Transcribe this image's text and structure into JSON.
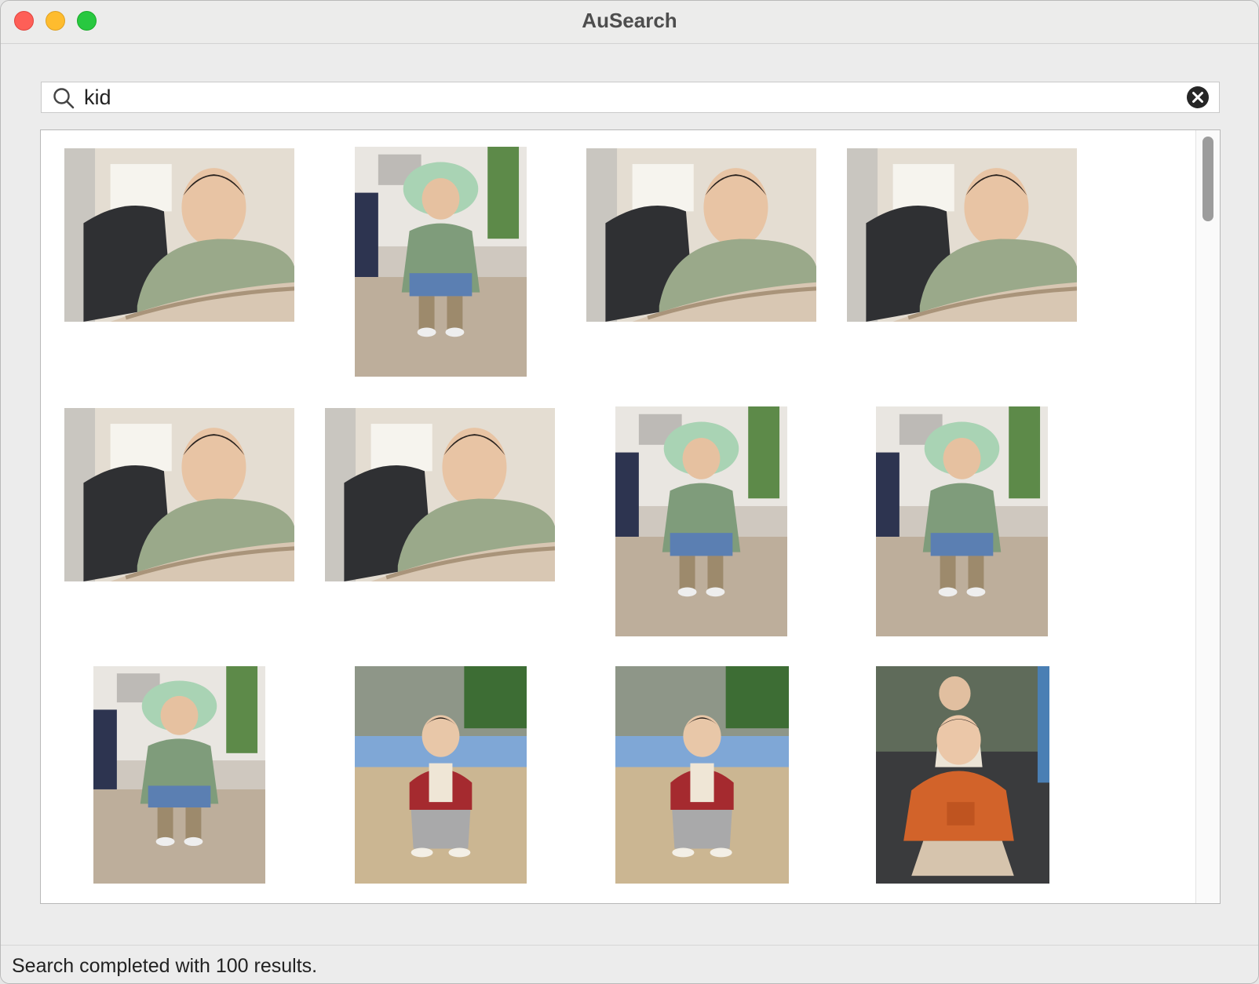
{
  "window": {
    "title": "AuSearch"
  },
  "search": {
    "value": "kid",
    "placeholder": ""
  },
  "results": {
    "items": [
      {
        "scene": "indoor-sitting"
      },
      {
        "scene": "standing-with-hat"
      },
      {
        "scene": "indoor-sitting"
      },
      {
        "scene": "indoor-sitting"
      },
      {
        "scene": "indoor-sitting"
      },
      {
        "scene": "indoor-sitting"
      },
      {
        "scene": "standing-with-hat"
      },
      {
        "scene": "standing-with-hat"
      },
      {
        "scene": "standing-with-hat"
      },
      {
        "scene": "playing-in-sand"
      },
      {
        "scene": "playing-in-sand"
      },
      {
        "scene": "orange-jacket"
      }
    ]
  },
  "status": {
    "text": "Search completed with 100 results."
  }
}
